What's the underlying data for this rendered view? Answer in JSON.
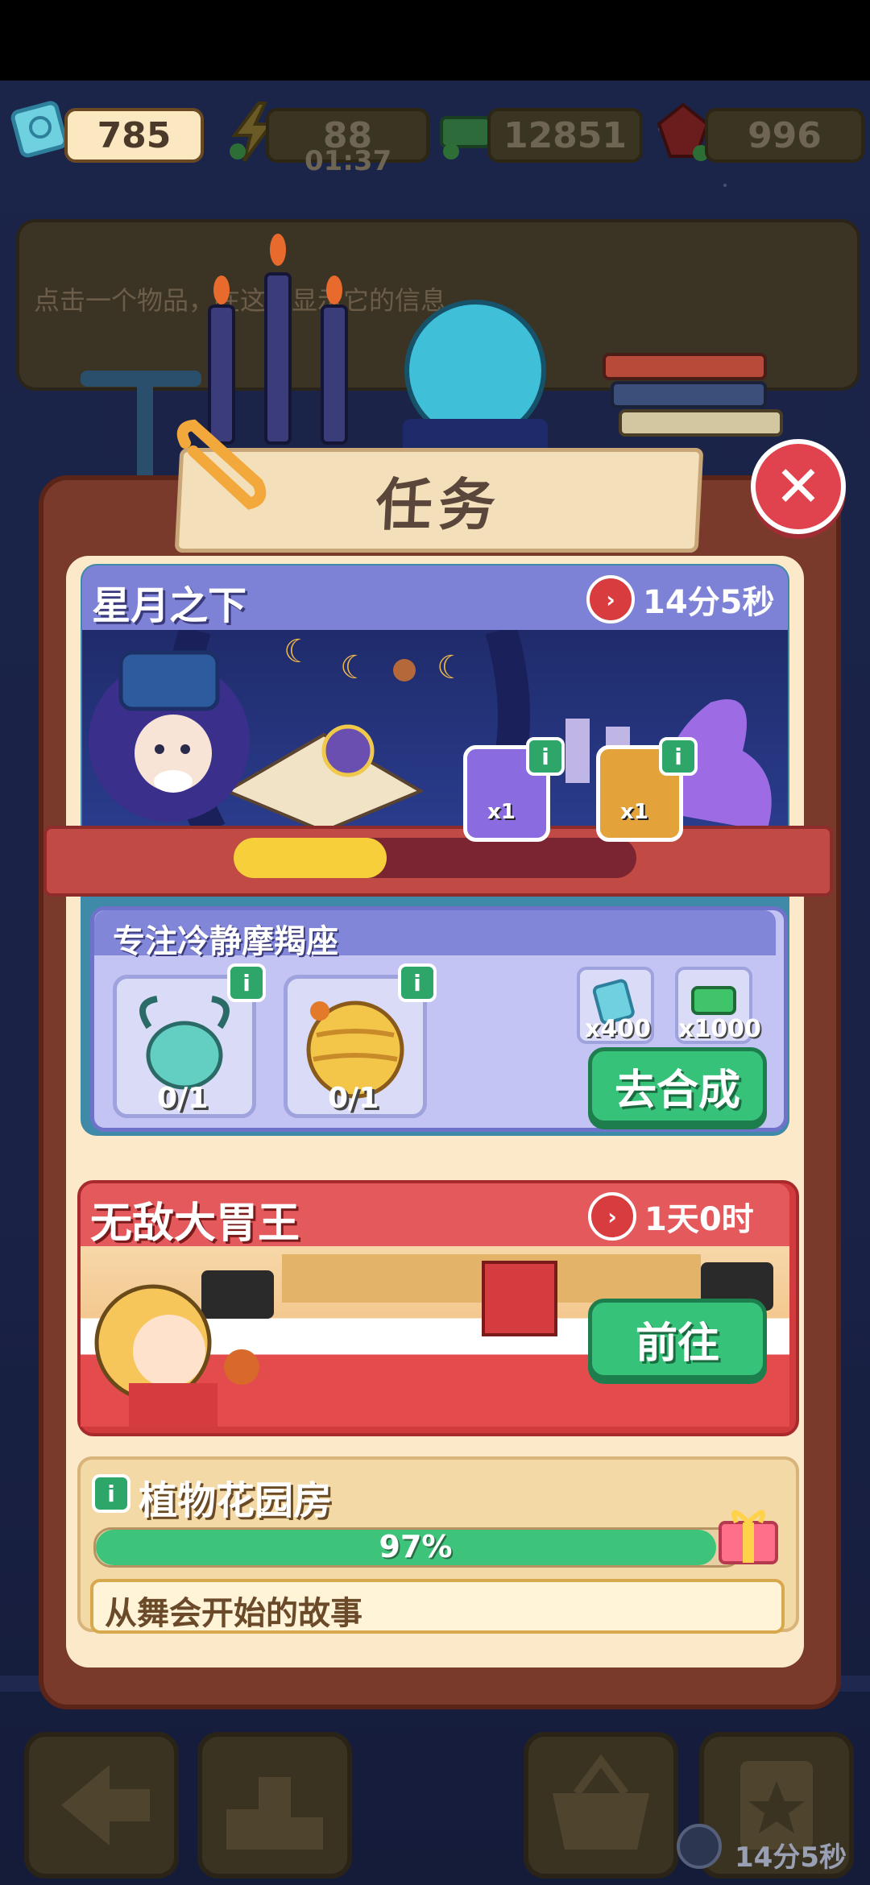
{
  "currencies": [
    {
      "icon": "ticket-icon",
      "value": "785"
    },
    {
      "icon": "lightning-icon",
      "value": "88",
      "timer": "01:37"
    },
    {
      "icon": "cash-icon",
      "value": "12851"
    },
    {
      "icon": "ruby-icon",
      "value": "996"
    }
  ],
  "info": {
    "text": "点击一个物品，在这处显示它的信息"
  },
  "modal": {
    "title": "任务",
    "close_icon": "close-icon"
  },
  "event": {
    "title": "星月之下",
    "timer": "14分5秒",
    "progress": 0.38,
    "rewards": [
      {
        "icon": "purple-chest-icon",
        "count": "x1"
      },
      {
        "icon": "gold-chest-icon",
        "count": "x1"
      }
    ],
    "task": {
      "title": "专注冷静摩羯座",
      "items": [
        {
          "icon": "capricorn-goat-icon",
          "count": "0/1"
        },
        {
          "icon": "golden-planet-icon",
          "count": "0/1"
        }
      ],
      "rewards": [
        {
          "icon": "ticket-icon",
          "count": "x400"
        },
        {
          "icon": "cash-icon",
          "count": "x1000"
        }
      ],
      "button": "去合成"
    }
  },
  "event2": {
    "title": "无敌大胃王",
    "timer": "1天0时",
    "button": "前往"
  },
  "event3": {
    "title": "植物花园房",
    "progress_label": "97%",
    "progress": 0.97
  },
  "event4": {
    "title": "从舞会开始的故事"
  },
  "toolbar": {
    "timer": "14分5秒"
  }
}
